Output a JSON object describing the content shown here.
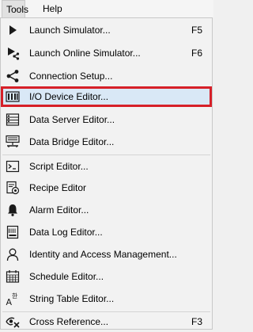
{
  "menubar": {
    "tools": "Tools",
    "help": "Help"
  },
  "menu": {
    "items": [
      {
        "label": "Launch Simulator...",
        "shortcut": "F5",
        "icon": "play-icon"
      },
      {
        "label": "Launch Online Simulator...",
        "shortcut": "F6",
        "icon": "online-simulator-icon"
      },
      {
        "label": "Connection Setup...",
        "shortcut": "",
        "icon": "share-icon"
      },
      {
        "label": "I/O Device Editor...",
        "shortcut": "",
        "icon": "io-device-icon"
      },
      {
        "label": "Data Server Editor...",
        "shortcut": "",
        "icon": "data-server-icon"
      },
      {
        "label": "Data Bridge Editor...",
        "shortcut": "",
        "icon": "data-bridge-icon"
      },
      {
        "label": "Script Editor...",
        "shortcut": "",
        "icon": "script-icon"
      },
      {
        "label": "Recipe Editor",
        "shortcut": "",
        "icon": "recipe-icon"
      },
      {
        "label": "Alarm Editor...",
        "shortcut": "",
        "icon": "bell-icon"
      },
      {
        "label": "Data Log Editor...",
        "shortcut": "",
        "icon": "data-log-icon"
      },
      {
        "label": "Identity and Access Management...",
        "shortcut": "",
        "icon": "user-icon"
      },
      {
        "label": "Schedule Editor...",
        "shortcut": "",
        "icon": "calendar-icon"
      },
      {
        "label": "String Table Editor...",
        "shortcut": "",
        "icon": "string-table-icon"
      },
      {
        "label": "Cross Reference...",
        "shortcut": "F3",
        "icon": "cross-reference-icon"
      }
    ],
    "selected_index": 3,
    "highlight_color": "#d62028"
  }
}
